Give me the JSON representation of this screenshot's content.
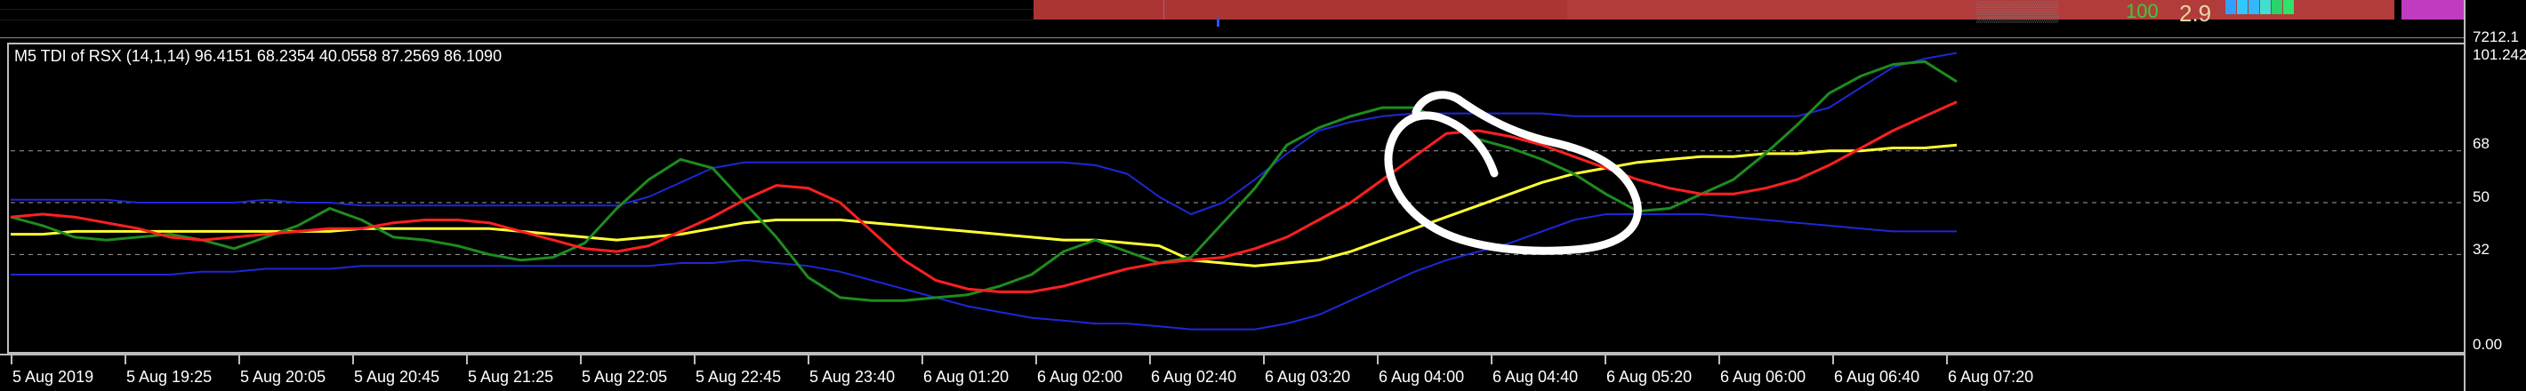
{
  "price_strip": {
    "price_label": "7212.1",
    "green_value": "100",
    "value": "2.9",
    "swatch_colors": [
      "#33a0ff",
      "#30c8ff",
      "#33b7ff",
      "#3fe0d0",
      "#2bd36a",
      "#30e36a"
    ]
  },
  "indicator": {
    "title": "M5 TDI of RSX  (14,1,14) 96.4151 68.2354 40.0558 87.2569 86.1090",
    "colors": {
      "upper_band": "#1e27d8",
      "lower_band": "#1e27d8",
      "middle_band": "#ffff33",
      "rsi_price_line": "#1e8c1e",
      "signal_line": "#ff2020",
      "level_lines": "#a0a0a0",
      "annotation": "#ffffff"
    }
  },
  "price_axis": {
    "labels": [
      "101.242",
      "68",
      "50",
      "32",
      "0.00"
    ]
  },
  "time_axis": {
    "labels": [
      "5 Aug 2019",
      "5 Aug 19:25",
      "5 Aug 20:05",
      "5 Aug 20:45",
      "5 Aug 21:25",
      "5 Aug 22:05",
      "5 Aug 22:45",
      "5 Aug 23:40",
      "6 Aug 01:20",
      "6 Aug 02:00",
      "6 Aug 02:40",
      "6 Aug 03:20",
      "6 Aug 04:00",
      "6 Aug 04:40",
      "6 Aug 05:20",
      "6 Aug 06:00",
      "6 Aug 06:40",
      "6 Aug 07:20"
    ]
  },
  "chart_data": {
    "type": "line",
    "ylim": [
      0,
      101.242
    ],
    "levels": [
      32,
      50,
      68
    ],
    "grid": "horizontal dashed at levels",
    "series": [
      {
        "key": "upper_band",
        "values": [
          51,
          51,
          51,
          51,
          50,
          50,
          50,
          50,
          51,
          50,
          50,
          49,
          49,
          49,
          49,
          49,
          49,
          49,
          49,
          49,
          52,
          57,
          62,
          64,
          64,
          64,
          64,
          64,
          64,
          64,
          64,
          64,
          64,
          64,
          63,
          60,
          52,
          46,
          50,
          58,
          67,
          75,
          78,
          80,
          81,
          81,
          81,
          81,
          81,
          80,
          80,
          80,
          80,
          80,
          80,
          80,
          80,
          83,
          90,
          97,
          100,
          102
        ]
      },
      {
        "key": "lower_band",
        "values": [
          25,
          25,
          25,
          25,
          25,
          25,
          26,
          26,
          27,
          27,
          27,
          28,
          28,
          28,
          28,
          28,
          28,
          28,
          28,
          28,
          28,
          29,
          29,
          30,
          29,
          28,
          26,
          23,
          20,
          17,
          14,
          12,
          10,
          9,
          8,
          8,
          7,
          6,
          6,
          6,
          8,
          11,
          16,
          21,
          26,
          30,
          33,
          36,
          40,
          44,
          46,
          46,
          46,
          46,
          45,
          44,
          43,
          42,
          41,
          40,
          40,
          40
        ]
      },
      {
        "key": "middle_band",
        "values": [
          39,
          39,
          40,
          40,
          40,
          40,
          40,
          40,
          40,
          40,
          40,
          41,
          41,
          41,
          41,
          41,
          40,
          39,
          38,
          37,
          38,
          39,
          41,
          43,
          44,
          44,
          44,
          43,
          42,
          41,
          40,
          39,
          38,
          37,
          37,
          36,
          35,
          30,
          29,
          28,
          29,
          30,
          33,
          37,
          41,
          45,
          49,
          53,
          57,
          60,
          62,
          64,
          65,
          66,
          66,
          67,
          67,
          68,
          68,
          69,
          69,
          70
        ]
      },
      {
        "key": "rsi_price_line",
        "values": [
          45,
          42,
          38,
          37,
          38,
          39,
          37,
          34,
          38,
          42,
          48,
          44,
          38,
          37,
          35,
          32,
          30,
          31,
          36,
          48,
          58,
          65,
          62,
          50,
          38,
          24,
          17,
          16,
          16,
          17,
          18,
          21,
          25,
          33,
          37,
          33,
          29,
          31,
          43,
          55,
          70,
          76,
          80,
          83,
          83,
          78,
          72,
          69,
          65,
          60,
          53,
          47,
          48,
          53,
          58,
          67,
          77,
          88,
          94,
          98,
          99,
          92
        ]
      },
      {
        "key": "signal_line",
        "values": [
          45,
          46,
          45,
          43,
          41,
          38,
          37,
          38,
          39,
          40,
          41,
          41,
          43,
          44,
          44,
          43,
          40,
          37,
          34,
          33,
          35,
          40,
          45,
          51,
          56,
          55,
          50,
          40,
          30,
          23,
          20,
          19,
          19,
          21,
          24,
          27,
          29,
          30,
          31,
          34,
          38,
          44,
          50,
          58,
          66,
          74,
          75,
          73,
          70,
          66,
          62,
          58,
          55,
          53,
          53,
          55,
          58,
          63,
          69,
          75,
          80,
          85
        ]
      }
    ]
  }
}
